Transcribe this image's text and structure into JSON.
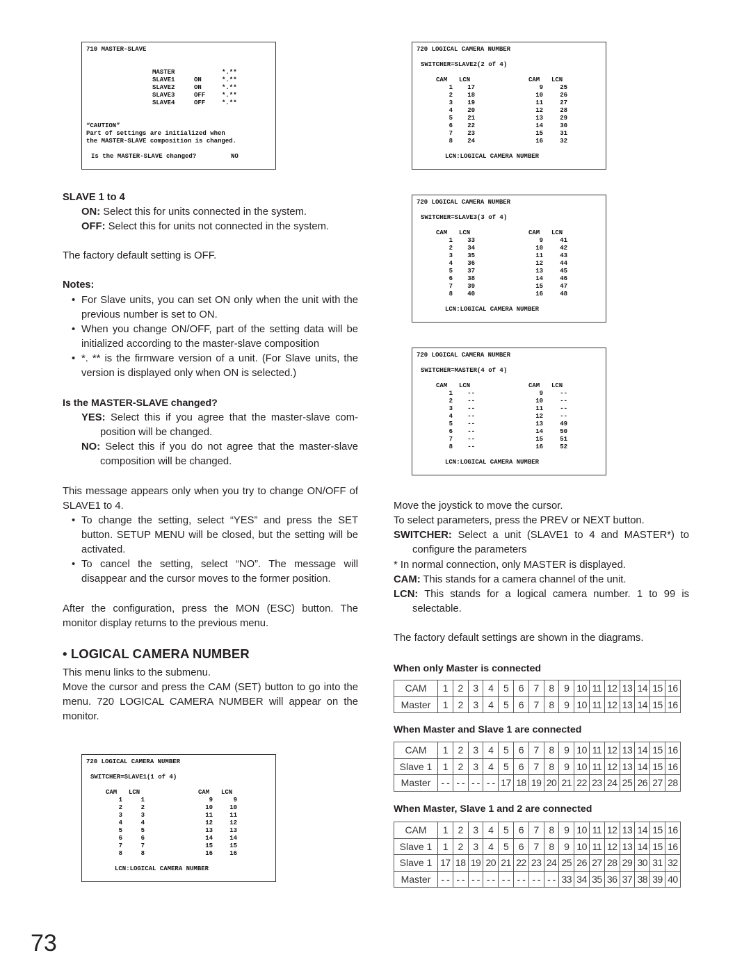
{
  "osd_master_slave": {
    "title": "710 MASTER-SLAVE",
    "rows": [
      {
        "unit": "MASTER",
        "state": "",
        "version": "*.**"
      },
      {
        "unit": "SLAVE1",
        "state": "ON",
        "version": "*.**"
      },
      {
        "unit": "SLAVE2",
        "state": "ON",
        "version": "*.**"
      },
      {
        "unit": "SLAVE3",
        "state": "OFF",
        "version": "*.**"
      },
      {
        "unit": "SLAVE4",
        "state": "OFF",
        "version": "*.**"
      }
    ],
    "caution_title": "“CAUTION”",
    "caution_line1": "Part of settings are initialized when",
    "caution_line2": "the MASTER-SLAVE composition is changed.",
    "question": "Is the MASTER-SLAVE changed?",
    "answer": "NO"
  },
  "osd_lcn": [
    {
      "title": "720 LOGICAL CAMERA NUMBER",
      "switcher": "SWITCHER=SLAVE2(2 of 4)",
      "header": [
        "CAM",
        "LCN",
        "CAM",
        "LCN"
      ],
      "left_cam": [
        "1",
        "2",
        "3",
        "4",
        "5",
        "6",
        "7",
        "8"
      ],
      "left_lcn": [
        "17",
        "18",
        "19",
        "20",
        "21",
        "22",
        "23",
        "24"
      ],
      "right_cam": [
        "9",
        "10",
        "11",
        "12",
        "13",
        "14",
        "15",
        "16"
      ],
      "right_lcn": [
        "25",
        "26",
        "27",
        "28",
        "29",
        "30",
        "31",
        "32"
      ],
      "footer": "LCN:LOGICAL CAMERA NUMBER"
    },
    {
      "title": "720 LOGICAL CAMERA NUMBER",
      "switcher": "SWITCHER=SLAVE3(3 of 4)",
      "header": [
        "CAM",
        "LCN",
        "CAM",
        "LCN"
      ],
      "left_cam": [
        "1",
        "2",
        "3",
        "4",
        "5",
        "6",
        "7",
        "8"
      ],
      "left_lcn": [
        "33",
        "34",
        "35",
        "36",
        "37",
        "38",
        "39",
        "40"
      ],
      "right_cam": [
        "9",
        "10",
        "11",
        "12",
        "13",
        "14",
        "15",
        "16"
      ],
      "right_lcn": [
        "41",
        "42",
        "43",
        "44",
        "45",
        "46",
        "47",
        "48"
      ],
      "footer": "LCN:LOGICAL CAMERA NUMBER"
    },
    {
      "title": "720 LOGICAL CAMERA NUMBER",
      "switcher": "SWITCHER=MASTER(4 of 4)",
      "header": [
        "CAM",
        "LCN",
        "CAM",
        "LCN"
      ],
      "left_cam": [
        "1",
        "2",
        "3",
        "4",
        "5",
        "6",
        "7",
        "8"
      ],
      "left_lcn": [
        "--",
        "--",
        "--",
        "--",
        "--",
        "--",
        "--",
        "--"
      ],
      "right_cam": [
        "9",
        "10",
        "11",
        "12",
        "13",
        "14",
        "15",
        "16"
      ],
      "right_lcn": [
        "--",
        "--",
        "--",
        "--",
        "49",
        "50",
        "51",
        "52"
      ],
      "footer": "LCN:LOGICAL CAMERA NUMBER"
    },
    {
      "title": "720 LOGICAL CAMERA NUMBER",
      "switcher": "SWITCHER=SLAVE1(1 of 4)",
      "header": [
        "CAM",
        "LCN",
        "CAM",
        "LCN"
      ],
      "left_cam": [
        "1",
        "2",
        "3",
        "4",
        "5",
        "6",
        "7",
        "8"
      ],
      "left_lcn": [
        "1",
        "2",
        "3",
        "4",
        "5",
        "6",
        "7",
        "8"
      ],
      "right_cam": [
        "9",
        "10",
        "11",
        "12",
        "13",
        "14",
        "15",
        "16"
      ],
      "right_lcn": [
        "9",
        "10",
        "11",
        "12",
        "13",
        "14",
        "15",
        "16"
      ],
      "footer": "LCN:LOGICAL CAMERA NUMBER"
    }
  ],
  "left": {
    "slave_heading": "SLAVE 1 to 4",
    "on_label": "ON:",
    "on_text": " Select this for units connected in the system.",
    "off_label": "OFF:",
    "off_text": " Select this for units not connected in the system.",
    "factory_default": "The factory default setting is OFF.",
    "notes_heading": "Notes:",
    "notes": [
      "For Slave units, you can set ON only when the unit with the previous number is set to ON.",
      "When you change ON/OFF, part of the setting data will be initialized according to the master-slave composition",
      "*. ** is the firmware version of a unit. (For Slave units, the version is displayed only when ON is selected.)"
    ],
    "question_heading": "Is the MASTER-SLAVE changed?",
    "yes_label": "YES:",
    "yes_text": " Select this if you agree that the master-slave com-position will be changed.",
    "no_label": "NO:",
    "no_text": " Select this if you do not agree that the master-slave composition will be changed.",
    "message_text": "This message appears only when you try to change ON/OFF of SLAVE1 to 4.",
    "message_bullets": [
      "To change the setting, select “YES” and press the SET button. SETUP MENU will be closed, but the setting will be activated.",
      "To cancel the setting, select “NO”. The message will disappear and the cursor moves to the former position."
    ],
    "after_config": "After the configuration, press the MON (ESC) button. The monitor display returns to the previous menu.",
    "section_title": "• LOGICAL CAMERA NUMBER",
    "section_line1": "This menu links to the submenu.",
    "section_line2": "Move the cursor and press the CAM (SET) button to go into the menu. 720 LOGICAL CAMERA NUMBER will appear on the monitor."
  },
  "right": {
    "joystick": "Move the joystick to move the cursor.",
    "select_params": "To select parameters, press the PREV or NEXT button.",
    "switcher_label": "SWITCHER:",
    "switcher_text": " Select a unit (SLAVE1 to 4 and MASTER*) to configure the parameters",
    "normal_note": "* In normal connection, only MASTER is displayed.",
    "cam_label": "CAM:",
    "cam_text": " This stands for a camera channel of the unit.",
    "lcn_label": "LCN:",
    "lcn_text": " This stands for a logical camera number. 1 to 99 is selectable.",
    "factory_diagrams": "The factory default settings are shown in the diagrams.",
    "tables": [
      {
        "heading": "When only Master is connected",
        "rows": [
          {
            "label": "CAM",
            "cells": [
              "1",
              "2",
              "3",
              "4",
              "5",
              "6",
              "7",
              "8",
              "9",
              "10",
              "11",
              "12",
              "13",
              "14",
              "15",
              "16"
            ]
          },
          {
            "label": "Master",
            "cells": [
              "1",
              "2",
              "3",
              "4",
              "5",
              "6",
              "7",
              "8",
              "9",
              "10",
              "11",
              "12",
              "13",
              "14",
              "15",
              "16"
            ]
          }
        ]
      },
      {
        "heading": "When Master and Slave 1 are connected",
        "rows": [
          {
            "label": "CAM",
            "cells": [
              "1",
              "2",
              "3",
              "4",
              "5",
              "6",
              "7",
              "8",
              "9",
              "10",
              "11",
              "12",
              "13",
              "14",
              "15",
              "16"
            ]
          },
          {
            "label": "Slave 1",
            "cells": [
              "1",
              "2",
              "3",
              "4",
              "5",
              "6",
              "7",
              "8",
              "9",
              "10",
              "11",
              "12",
              "13",
              "14",
              "15",
              "16"
            ]
          },
          {
            "label": "Master",
            "cells": [
              "- -",
              "- -",
              "- -",
              "- -",
              "17",
              "18",
              "19",
              "20",
              "21",
              "22",
              "23",
              "24",
              "25",
              "26",
              "27",
              "28"
            ]
          }
        ]
      },
      {
        "heading": "When Master, Slave 1 and 2 are connected",
        "rows": [
          {
            "label": "CAM",
            "cells": [
              "1",
              "2",
              "3",
              "4",
              "5",
              "6",
              "7",
              "8",
              "9",
              "10",
              "11",
              "12",
              "13",
              "14",
              "15",
              "16"
            ]
          },
          {
            "label": "Slave 1",
            "cells": [
              "1",
              "2",
              "3",
              "4",
              "5",
              "6",
              "7",
              "8",
              "9",
              "10",
              "11",
              "12",
              "13",
              "14",
              "15",
              "16"
            ]
          },
          {
            "label": "Slave 1",
            "cells": [
              "17",
              "18",
              "19",
              "20",
              "21",
              "22",
              "23",
              "24",
              "25",
              "26",
              "27",
              "28",
              "29",
              "30",
              "31",
              "32"
            ]
          },
          {
            "label": "Master",
            "cells": [
              "- -",
              "- -",
              "- -",
              "- -",
              "- -",
              "- -",
              "- -",
              "- -",
              "33",
              "34",
              "35",
              "36",
              "37",
              "38",
              "39",
              "40"
            ]
          }
        ]
      }
    ]
  },
  "page_number": "73"
}
